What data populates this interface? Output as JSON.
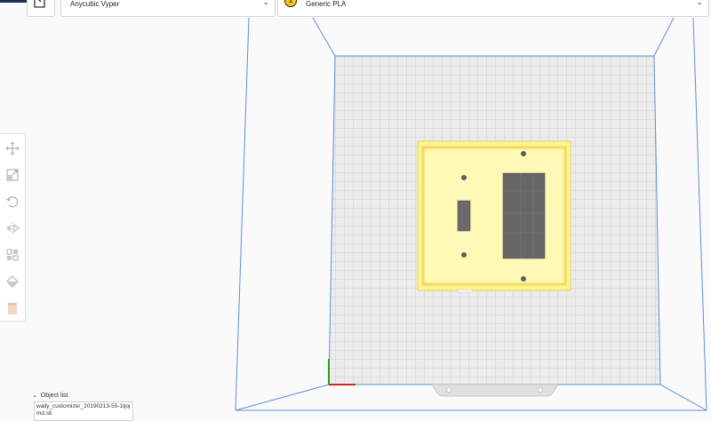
{
  "app": {
    "brand_color": "#1d2f5a",
    "accent_color": "#f6c814"
  },
  "header": {
    "open_file_icon": "open-file-icon",
    "printer": {
      "selected": "Anycubic Vyper"
    },
    "material": {
      "extruder_number": "1",
      "selected": "Generic PLA"
    }
  },
  "toolbar": {
    "tools": [
      "move-icon",
      "scale-icon",
      "rotate-icon",
      "mirror-icon",
      "per-model-settings-icon",
      "support-blocker-icon",
      "tool-swatch-icon"
    ]
  },
  "object_list": {
    "header": "Object list",
    "items": [
      "wally_customizer_20190213-55-1tjojmd.stl"
    ]
  },
  "viewport": {
    "bed_color": "#e9e9e9",
    "build_volume_color": "#4f86d6",
    "model_color": "#fff18a",
    "axis_x_color": "#d62424",
    "axis_y_color": "#23a323"
  }
}
